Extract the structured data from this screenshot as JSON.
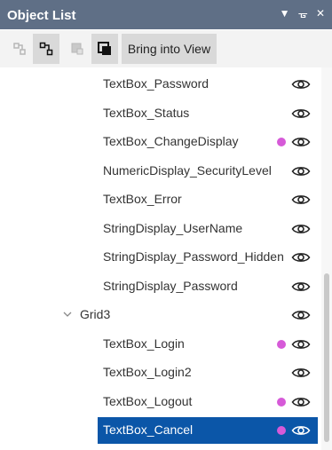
{
  "panel": {
    "title": "Object List",
    "controls": {
      "menu_icon": "dropdown-arrow-icon",
      "pin_icon": "pin-icon",
      "close_icon": "close-icon",
      "menu_glyph": "▼",
      "pin_glyph": "ᚗ",
      "close_glyph": "✕"
    }
  },
  "toolbar": {
    "bring_into_view_label": "Bring into View"
  },
  "tree": {
    "items": [
      {
        "label": "TextBox_Password",
        "dot": false,
        "selected": false
      },
      {
        "label": "TextBox_Status",
        "dot": false,
        "selected": false
      },
      {
        "label": "TextBox_ChangeDisplay",
        "dot": true,
        "selected": false
      },
      {
        "label": "NumericDisplay_SecurityLevel",
        "dot": false,
        "selected": false
      },
      {
        "label": "TextBox_Error",
        "dot": false,
        "selected": false
      },
      {
        "label": "StringDisplay_UserName",
        "dot": false,
        "selected": false
      },
      {
        "label": "StringDisplay_Password_Hidden",
        "dot": false,
        "selected": false
      },
      {
        "label": "StringDisplay_Password",
        "dot": false,
        "selected": false
      },
      {
        "label": "Grid3",
        "dot": false,
        "selected": false,
        "group": true
      },
      {
        "label": "TextBox_Login",
        "dot": true,
        "selected": false
      },
      {
        "label": "TextBox_Login2",
        "dot": false,
        "selected": false
      },
      {
        "label": "TextBox_Logout",
        "dot": true,
        "selected": false
      },
      {
        "label": "TextBox_Cancel",
        "dot": true,
        "selected": true
      }
    ]
  },
  "colors": {
    "titlebar": "#5f6f86",
    "selection": "#0b56a8",
    "dot": "#d65ad8"
  }
}
